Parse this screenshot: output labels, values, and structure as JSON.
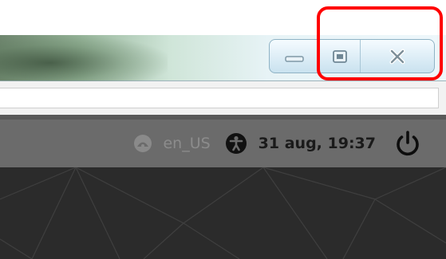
{
  "window": {
    "controls": {
      "minimize_icon": "minimize-icon",
      "maximize_icon": "maximize-icon",
      "close_icon": "close-icon"
    }
  },
  "address_bar": {
    "value": ""
  },
  "top_bar": {
    "network_icon": "network-icon",
    "language": "en_US",
    "accessibility_icon": "accessibility-icon",
    "datetime": "31 aug, 19:37",
    "power_icon": "power-icon"
  },
  "colors": {
    "highlight": "#ff0000",
    "panel": "#6b6b6b",
    "login_background": "#2b2b2b"
  }
}
